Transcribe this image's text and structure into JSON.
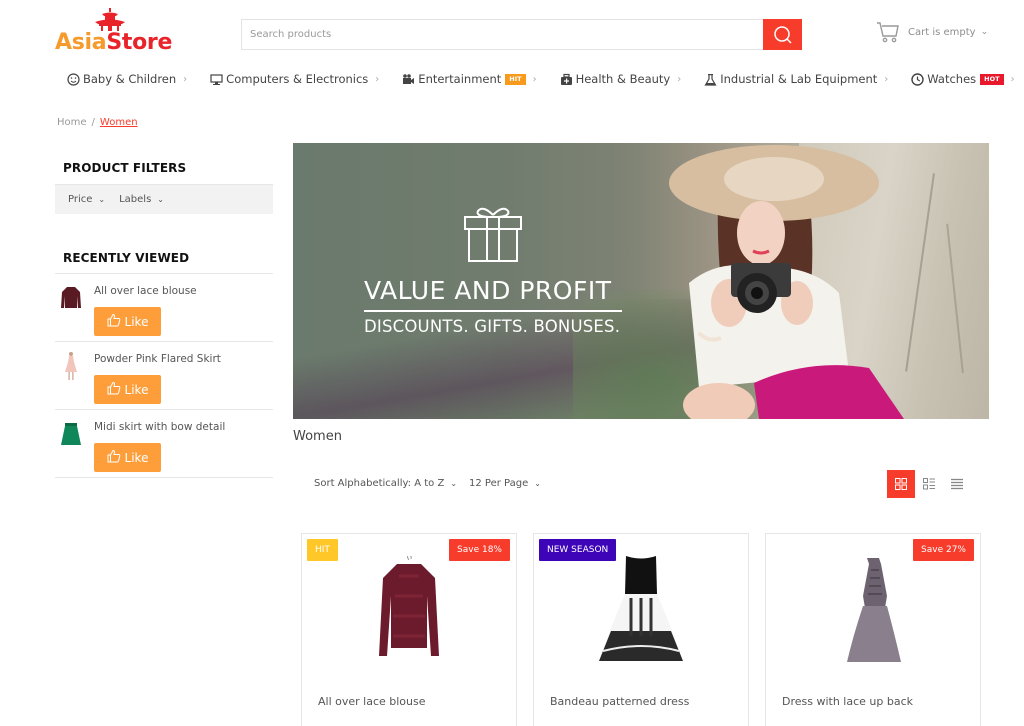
{
  "brand": {
    "name_part1": "Asia",
    "name_part2": "Store",
    "colors": {
      "orange": "#f59a2b",
      "red": "#e8232a"
    }
  },
  "search": {
    "placeholder": "Search products",
    "value": "",
    "icon": "search-icon"
  },
  "cart": {
    "label": "Cart is empty",
    "icon": "cart-icon"
  },
  "nav": {
    "items": [
      {
        "label": "Baby & Children",
        "icon": "smiley-icon",
        "badge": null
      },
      {
        "label": "Computers & Electronics",
        "icon": "monitor-icon",
        "badge": null
      },
      {
        "label": "Entertainment",
        "icon": "camera-icon",
        "badge": "HIT"
      },
      {
        "label": "Health & Beauty",
        "icon": "medkit-icon",
        "badge": null
      },
      {
        "label": "Industrial & Lab Equipment",
        "icon": "flask-icon",
        "badge": null
      },
      {
        "label": "Watches",
        "icon": "clock-icon",
        "badge": "HOT"
      }
    ]
  },
  "breadcrumb": {
    "home": "Home",
    "separator": "/",
    "current": "Women"
  },
  "sidebar": {
    "filters_title": "PRODUCT FILTERS",
    "filters": [
      {
        "label": "Price"
      },
      {
        "label": "Labels"
      }
    ],
    "recent_title": "RECENTLY VIEWED",
    "like_label": "Like",
    "recent": [
      {
        "name": "All over lace blouse"
      },
      {
        "name": "Powder Pink Flared Skirt"
      },
      {
        "name": "Midi skirt with bow detail"
      }
    ]
  },
  "banner": {
    "headline": "VALUE AND PROFIT",
    "subline": "DISCOUNTS. GIFTS. BONUSES.",
    "icon": "gift-icon"
  },
  "listing": {
    "title": "Women",
    "sort_label": "Sort Alphabetically: A to Z",
    "per_page_label": "12 Per Page",
    "view_modes": [
      "grid",
      "list-grid",
      "list"
    ],
    "active_view": "grid",
    "accent": "#f73c2b"
  },
  "products": [
    {
      "name": "All over lace blouse",
      "label": "HIT",
      "save": "Save 18%"
    },
    {
      "name": "Bandeau patterned dress",
      "label": "NEW SEASON",
      "save": null
    },
    {
      "name": "Dress with lace up back",
      "label": null,
      "save": "Save 27%"
    }
  ]
}
